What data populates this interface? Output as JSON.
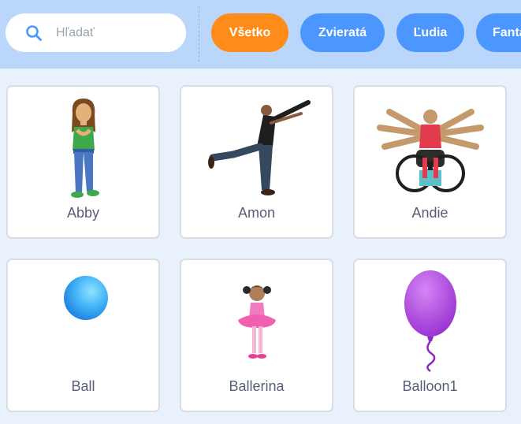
{
  "search": {
    "placeholder": "Hľadať",
    "value": ""
  },
  "categories": [
    {
      "label": "Všetko",
      "active": true
    },
    {
      "label": "Zvieratá",
      "active": false
    },
    {
      "label": "Ľudia",
      "active": false
    },
    {
      "label": "Fantasy",
      "active": false
    }
  ],
  "sprites": [
    {
      "name": "Abby",
      "icon": "abby-sprite-icon"
    },
    {
      "name": "Amon",
      "icon": "amon-sprite-icon"
    },
    {
      "name": "Andie",
      "icon": "andie-sprite-icon"
    },
    {
      "name": "Ball",
      "icon": "ball-sprite-icon"
    },
    {
      "name": "Ballerina",
      "icon": "ballerina-sprite-icon"
    },
    {
      "name": "Balloon1",
      "icon": "balloon-sprite-icon"
    }
  ],
  "colors": {
    "topbar": "#bad6fb",
    "accent": "#4c97ff",
    "active": "#ff8c1a",
    "background": "#e9f1fc"
  }
}
